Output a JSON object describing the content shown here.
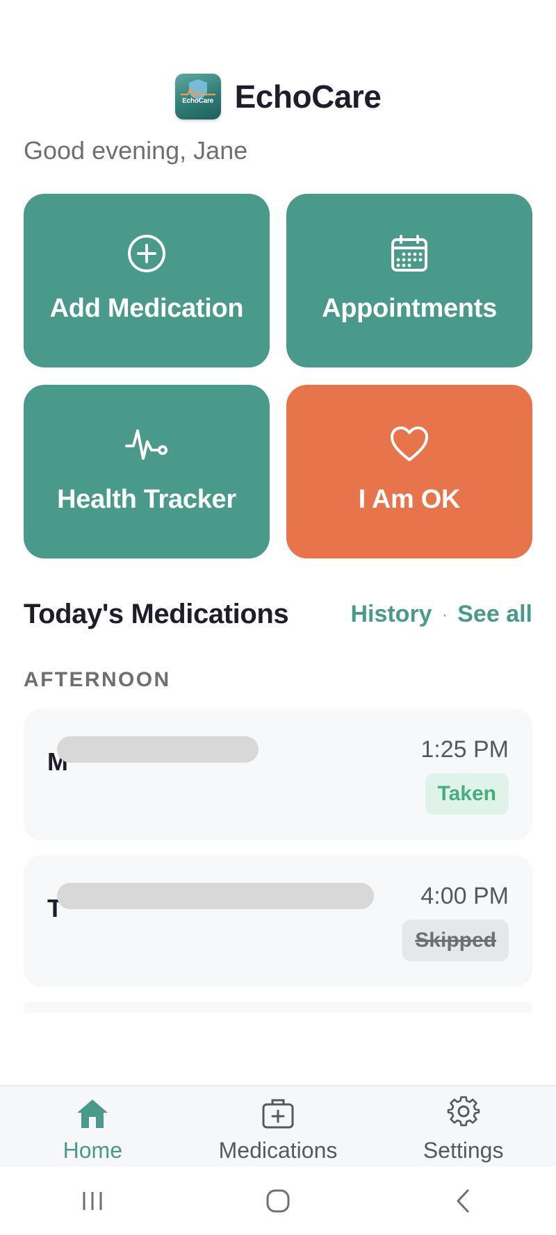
{
  "app": {
    "title": "EchoCare",
    "logo_text": "EchoCare",
    "greeting": "Good evening, Jane"
  },
  "tiles": [
    {
      "label": "Add Medication",
      "icon": "plus-circle-icon",
      "color": "#4a9a8c"
    },
    {
      "label": "Appointments",
      "icon": "calendar-icon",
      "color": "#4a9a8c"
    },
    {
      "label": "Health Tracker",
      "icon": "pulse-icon",
      "color": "#4a9a8c"
    },
    {
      "label": "I Am OK",
      "icon": "heart-icon",
      "color": "#e8744c"
    }
  ],
  "medications_section": {
    "title": "Today's Medications",
    "history_link": "History",
    "separator": "·",
    "see_all_link": "See all",
    "period": "AFTERNOON",
    "items": [
      {
        "name_initial": "M",
        "time": "1:25 PM",
        "status": "Taken"
      },
      {
        "name_initial": "T",
        "time": "4:00 PM",
        "status": "Skipped"
      }
    ]
  },
  "bottom_nav": [
    {
      "label": "Home",
      "icon": "home-icon",
      "active": true
    },
    {
      "label": "Medications",
      "icon": "medkit-icon",
      "active": false
    },
    {
      "label": "Settings",
      "icon": "gear-icon",
      "active": false
    }
  ],
  "colors": {
    "accent": "#4a9a8c",
    "alert": "#e8744c",
    "taken": "#48ad7e",
    "text_dark": "#1d1d2b",
    "text_muted": "#6d6f74"
  }
}
